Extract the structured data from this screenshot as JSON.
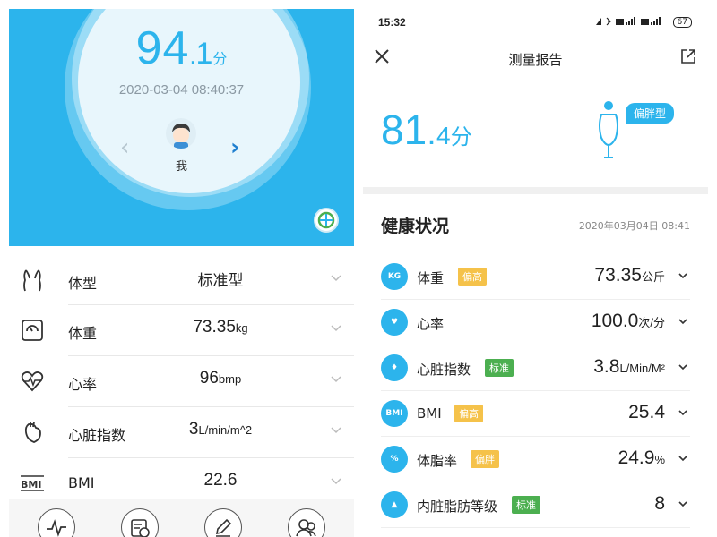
{
  "left": {
    "score": {
      "int": "94",
      "dot": ".",
      "dec": "1",
      "unit": "分"
    },
    "datetime": "2020-03-04 08:40:37",
    "prev_glyph": "‹",
    "next_glyph": "›",
    "user_name": "我",
    "metrics": [
      {
        "icon": "body-shape-icon",
        "label": "体型",
        "value": "标准型",
        "unit": ""
      },
      {
        "icon": "scale-icon",
        "label": "体重",
        "value": "73.35",
        "unit": "kg"
      },
      {
        "icon": "heart-rate-icon",
        "label": "心率",
        "value": "96",
        "unit": "bmp"
      },
      {
        "icon": "heart-index-icon",
        "label": "心脏指数",
        "value": "3",
        "unit": "L/min/m^2"
      },
      {
        "icon": "bmi-icon",
        "label": "BMI",
        "value": "22.6",
        "unit": ""
      }
    ],
    "tabs": [
      "pulse-icon",
      "history-icon",
      "edit-icon",
      "family-icon"
    ]
  },
  "right": {
    "status": {
      "time": "15:32",
      "battery": "67"
    },
    "title": "测量报告",
    "score": {
      "int": "81",
      "dot": ".",
      "dec": "4",
      "unit": "分"
    },
    "body_type": "偏胖型",
    "section_title": "健康状况",
    "section_date": "2020年03月04日 08:41",
    "metrics": [
      {
        "icon_text": "KG",
        "label": "体重",
        "badge": "偏高",
        "badge_type": "warn",
        "value": "73.35",
        "unit": "公斤"
      },
      {
        "icon_text": "♥",
        "label": "心率",
        "badge": "",
        "badge_type": "",
        "value": "100.0",
        "unit": "次/分"
      },
      {
        "icon_text": "♦",
        "label": "心脏指数",
        "badge": "标准",
        "badge_type": "ok",
        "value": "3.8",
        "unit": "L/Min/M²"
      },
      {
        "icon_text": "BMI",
        "label": "BMI",
        "badge": "偏高",
        "badge_type": "warn",
        "value": "25.4",
        "unit": ""
      },
      {
        "icon_text": "%",
        "label": "体脂率",
        "badge": "偏胖",
        "badge_type": "warn",
        "value": "24.9",
        "unit": "%"
      },
      {
        "icon_text": "▲",
        "label": "内脏脂肪等级",
        "badge": "标准",
        "badge_type": "ok",
        "value": "8",
        "unit": ""
      }
    ],
    "colors": {
      "accent": "#2cb4ec",
      "warn": "#f5c24a",
      "ok": "#4caf50"
    }
  }
}
